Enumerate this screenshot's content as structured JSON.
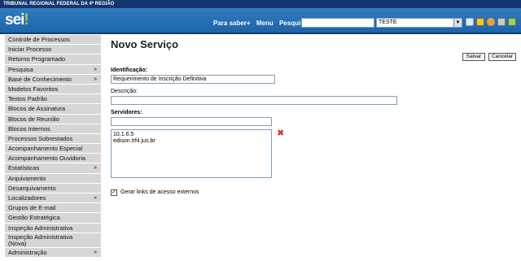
{
  "org_bar": {
    "title": "TRIBUNAL REGIONAL FEDERAL DA 4ª REGIÃO"
  },
  "header": {
    "logo_text": "sei",
    "logo_mark": "!",
    "links": [
      "Para saber+",
      "Menu",
      "Pesquisa"
    ],
    "search_value": "",
    "unit_selected": "TESTE",
    "icons": [
      "grid-icon",
      "notes-icon",
      "user-icon",
      "tools-icon",
      "exit-icon"
    ]
  },
  "sidebar": {
    "items": [
      {
        "label": "Controle de Processos",
        "has_more": false
      },
      {
        "label": "Iniciar Processo",
        "has_more": false
      },
      {
        "label": "Retorno Programado",
        "has_more": false
      },
      {
        "label": "Pesquisa",
        "has_more": true
      },
      {
        "label": "Base de Conhecimento",
        "has_more": true
      },
      {
        "label": "Modelos Favoritos",
        "has_more": false
      },
      {
        "label": "Textos Padrão",
        "has_more": false
      },
      {
        "label": "Blocos de Assinatura",
        "has_more": false
      },
      {
        "label": "Blocos de Reunião",
        "has_more": false
      },
      {
        "label": "Blocos Internos",
        "has_more": false
      },
      {
        "label": "Processos Sobrestados",
        "has_more": false
      },
      {
        "label": "Acompanhamento Especial",
        "has_more": false
      },
      {
        "label": "Acompanhamento Ouvidoria",
        "has_more": false
      },
      {
        "label": "Estatísticas",
        "has_more": true
      },
      {
        "label": "Arquivamento",
        "has_more": false
      },
      {
        "label": "Desarquivamento",
        "has_more": false
      },
      {
        "label": "Localizadores",
        "has_more": true
      },
      {
        "label": "Grupos de E-mail",
        "has_more": false
      },
      {
        "label": "Gestão Estratégica",
        "has_more": false
      },
      {
        "label": "Inspeção Administrativa",
        "has_more": false
      },
      {
        "label": "Inspeção Administrativa (Nova)",
        "has_more": false
      },
      {
        "label": "Administração",
        "has_more": true
      }
    ],
    "more_glyph": "»"
  },
  "main": {
    "title": "Novo Serviço",
    "save_label": "Salvar",
    "cancel_label": "Cancelar",
    "identification_label": "Identificação:",
    "identification_value": "Requerimento de Inscrição Definitiva",
    "description_label": "Descrição:",
    "description_value": "",
    "servers_label": "Servidores:",
    "servers_input_value": "",
    "servers": [
      "10.1.6.5",
      "edison.trf4.jus.br"
    ],
    "remove_glyph": "✖",
    "generate_links_checked": true,
    "generate_links_label": "Gerar links de acesso externos",
    "check_glyph": "✓"
  },
  "colors": {
    "header_bg": "#1e64a8",
    "org_bar_bg": "#14366e",
    "menu_item_bg": "#d6d6d6",
    "remove_red": "#d62c2c",
    "logo_accent": "#9ed13a"
  }
}
